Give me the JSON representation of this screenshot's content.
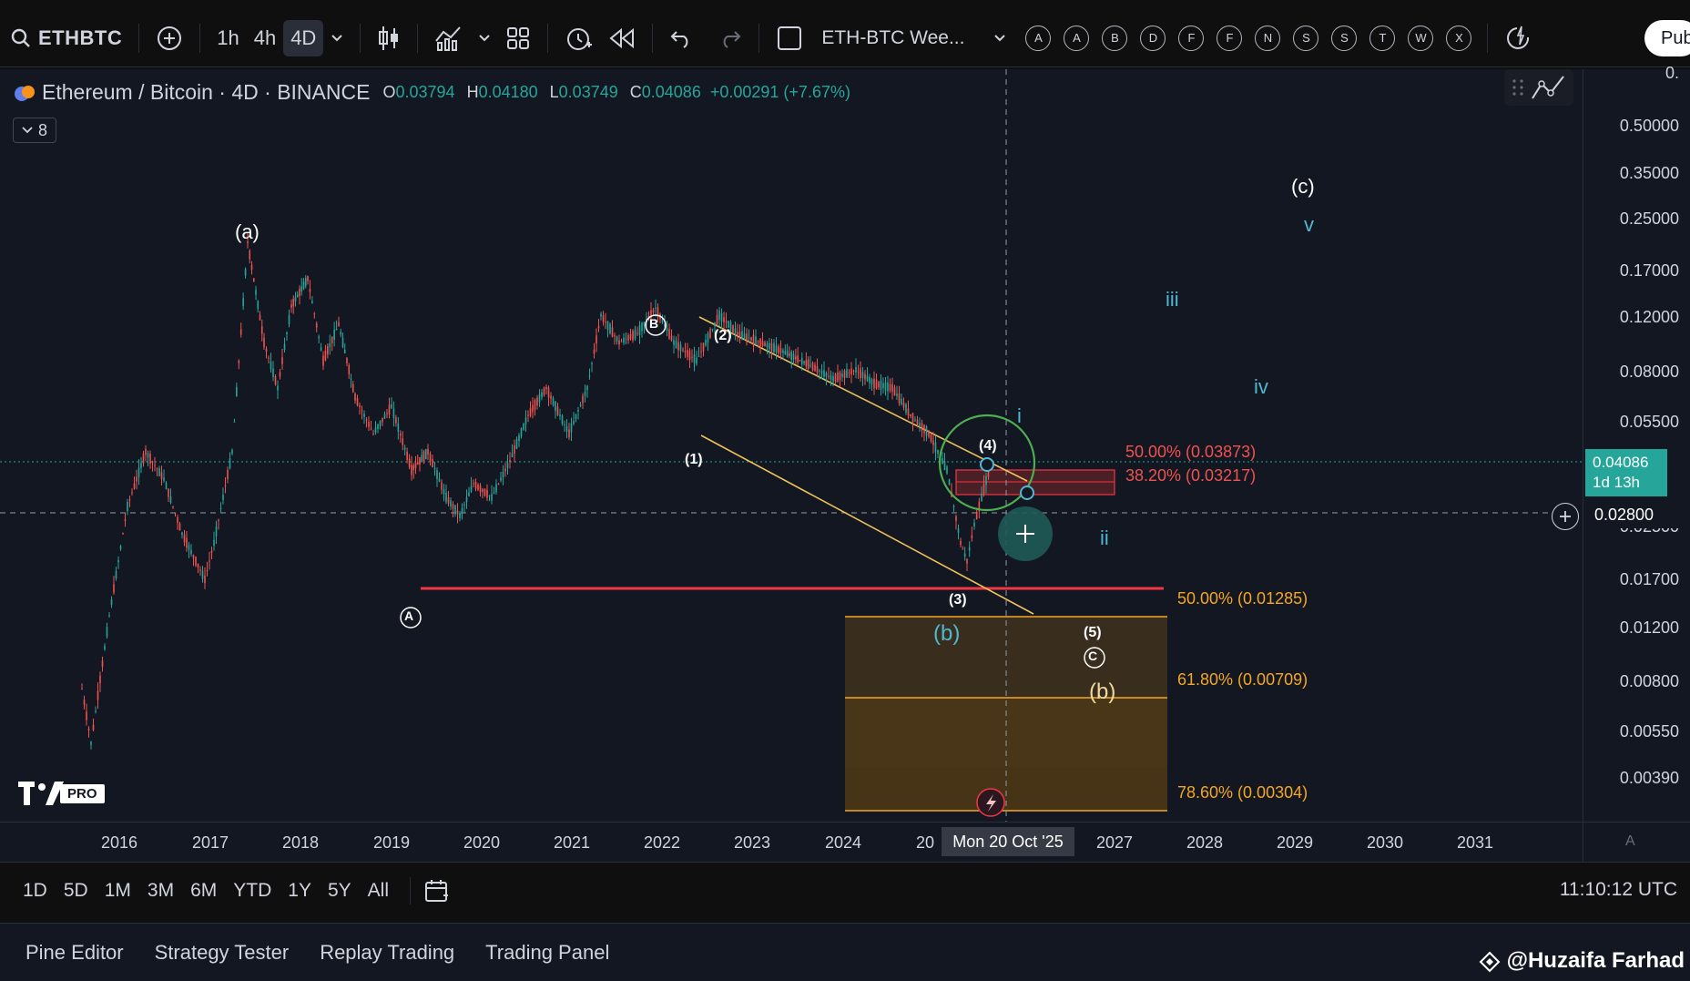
{
  "toolbar": {
    "symbol": "ETHBTC",
    "intervals": [
      "1h",
      "4h",
      "4D"
    ],
    "active_interval": "4D",
    "layout_name": "ETH-BTC Wee...",
    "hotlist_letters": [
      "A",
      "A",
      "B",
      "D",
      "F",
      "F",
      "N",
      "S",
      "S",
      "T",
      "W",
      "X"
    ],
    "publish_label": "Pub"
  },
  "legend": {
    "title": "Ethereum / Bitcoin · 4D · BINANCE",
    "open_label": "O",
    "open": "0.03794",
    "high_label": "H",
    "high": "0.04180",
    "low_label": "L",
    "low": "0.03749",
    "close_label": "C",
    "close": "0.04086",
    "change": "+0.00291 (+7.67%)",
    "collapsed_count": "8"
  },
  "price_axis": {
    "labels": [
      "0.50000",
      "0.35000",
      "0.25000",
      "0.17000",
      "0.12000",
      "0.08000",
      "0.05500",
      "0.02500",
      "0.01700",
      "0.01200",
      "0.00800",
      "0.00550",
      "0.00390"
    ],
    "top_partial": "0.",
    "current_price": "0.04086",
    "countdown": "1d 13h",
    "crosshair_price": "0.02800"
  },
  "time_axis": {
    "labels": [
      "2016",
      "2017",
      "2018",
      "2019",
      "2020",
      "2021",
      "2022",
      "2023",
      "2024",
      "20",
      "2027",
      "2028",
      "2029",
      "2030",
      "2031"
    ],
    "crosshair_time": "Mon 20 Oct '25",
    "corner_label": "A"
  },
  "annotations": {
    "wave_a": "(a)",
    "wave_c_top": "(c)",
    "circle_A": "A",
    "circle_B": "B",
    "circle_C": "C",
    "w1": "(1)",
    "w2": "(2)",
    "w3": "(3)",
    "w4": "(4)",
    "w5": "(5)",
    "b_cyan": "(b)",
    "b_yellow": "(b)",
    "i": "i",
    "ii": "ii",
    "iii": "iii",
    "iv": "iv",
    "v": "v",
    "fib_top_50": "50.00% (0.03873)",
    "fib_top_382": "38.20% (0.03217)",
    "fib_low_50": "50.00% (0.01285)",
    "fib_low_618": "61.80% (0.00709)",
    "fib_low_786": "78.60% (0.00304)",
    "tv_badge": "PRO"
  },
  "range_bar": {
    "items": [
      "1D",
      "5D",
      "1M",
      "3M",
      "6M",
      "YTD",
      "1Y",
      "5Y",
      "All"
    ],
    "clock": "11:10:12 UTC"
  },
  "bottom_bar": {
    "items": [
      "Pine Editor",
      "Strategy Tester",
      "Replay Trading",
      "Trading Panel"
    ],
    "watermark": "@Huzaifa Farhad"
  },
  "colors": {
    "up": "#26a69a",
    "down": "#ef5350",
    "channel": "#f0c35a",
    "support": "#f23645",
    "cyan_wave": "#4fb8d3",
    "fib_orange": "#f5a623"
  }
}
